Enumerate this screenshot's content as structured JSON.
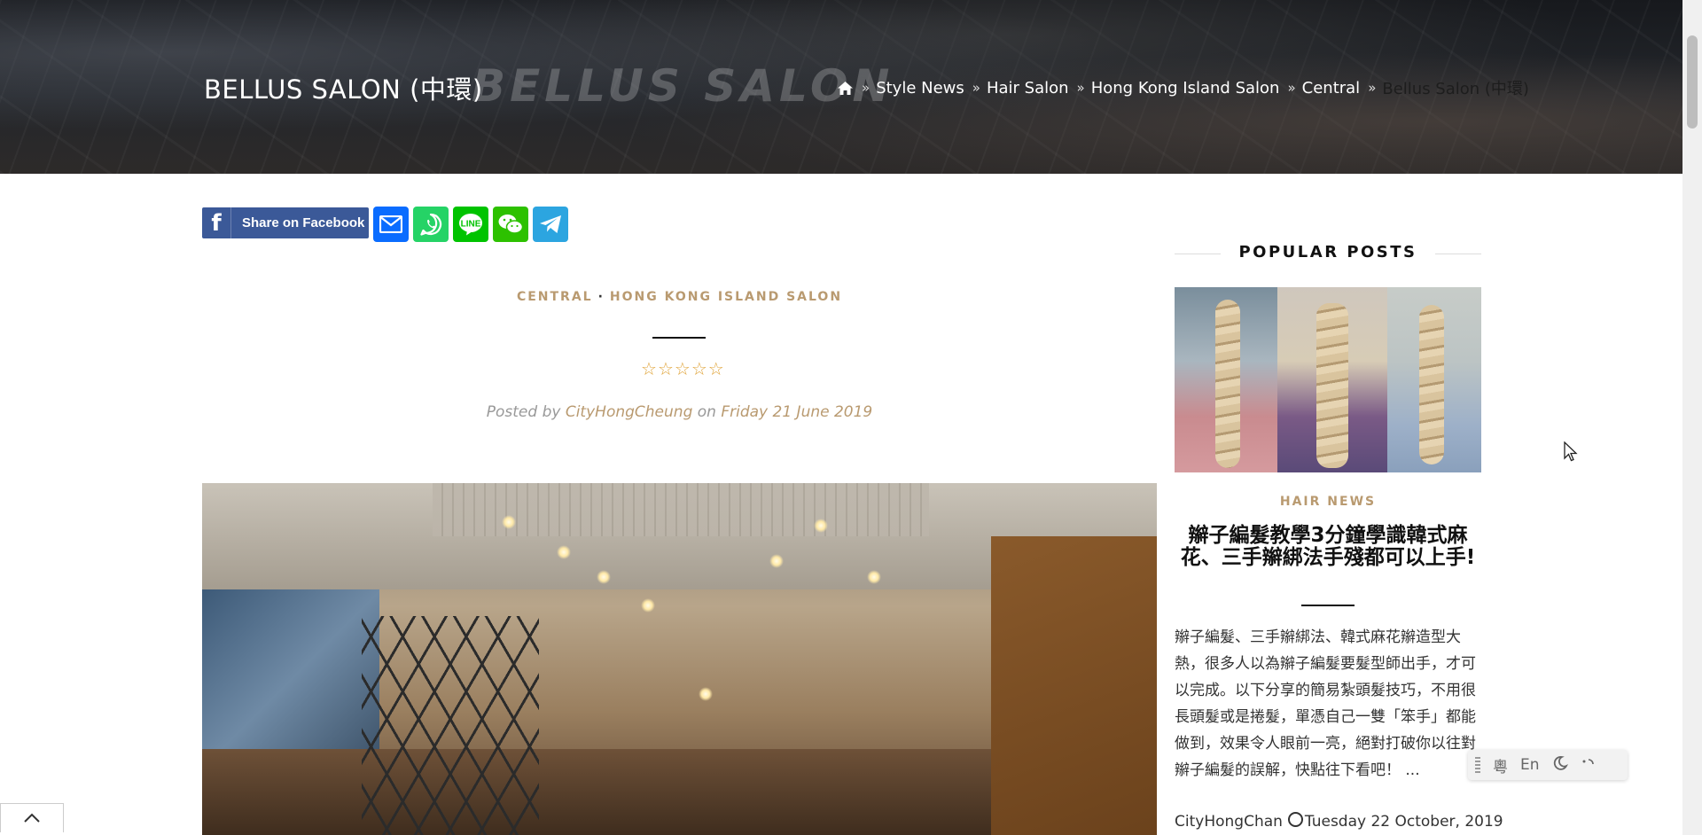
{
  "header": {
    "title": "BELLUS SALON (中環)",
    "ghost_title": "BELLUS SALON",
    "breadcrumb": {
      "items": [
        "Style News",
        "Hair Salon",
        "Hong Kong Island Salon",
        "Central"
      ],
      "current": "Bellus Salon (中環)"
    }
  },
  "share": {
    "facebook_label": "Share on Facebook",
    "colors": {
      "facebook": "#3b5998",
      "email": "#0a6cff",
      "whatsapp": "#25d366",
      "line": "#00c300",
      "wechat": "#2dc100",
      "telegram": "#2ca5e0"
    }
  },
  "article": {
    "categories": [
      "CENTRAL",
      "HONG KONG ISLAND SALON"
    ],
    "rating": 0,
    "rating_max": 5,
    "posted_prefix": "Posted by",
    "author": "CityHongCheung",
    "posted_on": "on",
    "date": "Friday 21 June 2019"
  },
  "sidebar": {
    "heading": "POPULAR POSTS",
    "post": {
      "category": "HAIR NEWS",
      "title": "辮子編髮教學3分鐘學識韓式麻花、三手辮綁法手殘都可以上手!",
      "excerpt": "辮子編髮、三手辮綁法、韓式麻花辮造型大熱，很多人以為辮子編髮要髮型師出手，才可以完成。以下分享的簡易紮頭髮技巧，不用很長頭髮或是捲髮，單憑自己一雙「笨手」都能做到，效果令人眼前一亮，絕對打破你以往對辮子編髮的誤解，快點往下看吧！ ...",
      "author": "CityHongChan",
      "date": "Tuesday 22 October, 2019"
    }
  },
  "toolbar": {
    "lang_cantonese": "粵",
    "lang_english": "En"
  },
  "accent_color": "#b99a70"
}
